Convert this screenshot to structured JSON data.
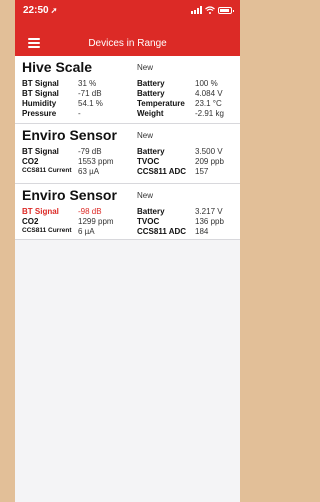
{
  "status_bar": {
    "time": "22:50",
    "location_glyph": "➚"
  },
  "header": {
    "title": "Devices in Range",
    "menu_icon": "hamburger-menu-icon"
  },
  "colors": {
    "accent": "#dc2a26",
    "background": "#e2bf98",
    "list_bg": "#f4f4f6"
  },
  "devices": [
    {
      "name": "Hive Scale",
      "status": "New",
      "rows": [
        [
          "BT Signal",
          "31 %",
          "Battery",
          "100 %"
        ],
        [
          "BT Signal",
          "-71 dB",
          "Battery",
          "4.084 V"
        ],
        [
          "Humidity",
          "54.1 %",
          "Temperature",
          "23.1 °C"
        ],
        [
          "Pressure",
          "-",
          "Weight",
          "-2.91 kg"
        ]
      ]
    },
    {
      "name": "Enviro Sensor",
      "status": "New",
      "rows": [
        [
          "BT Signal",
          "-79 dB",
          "Battery",
          "3.500 V"
        ],
        [
          "CO2",
          "1553 ppm",
          "TVOC",
          "209 ppb"
        ],
        [
          "CCS811 Current",
          "63 µA",
          "CCS811 ADC",
          "157"
        ]
      ]
    },
    {
      "name": "Enviro Sensor",
      "status": "New",
      "rows": [
        [
          "BT Signal",
          "-98 dB",
          "Battery",
          "3.217 V"
        ],
        [
          "CO2",
          "1299 ppm",
          "TVOC",
          "136 ppb"
        ],
        [
          "CCS811 Current",
          "6 µA",
          "CCS811 ADC",
          "184"
        ]
      ]
    }
  ]
}
